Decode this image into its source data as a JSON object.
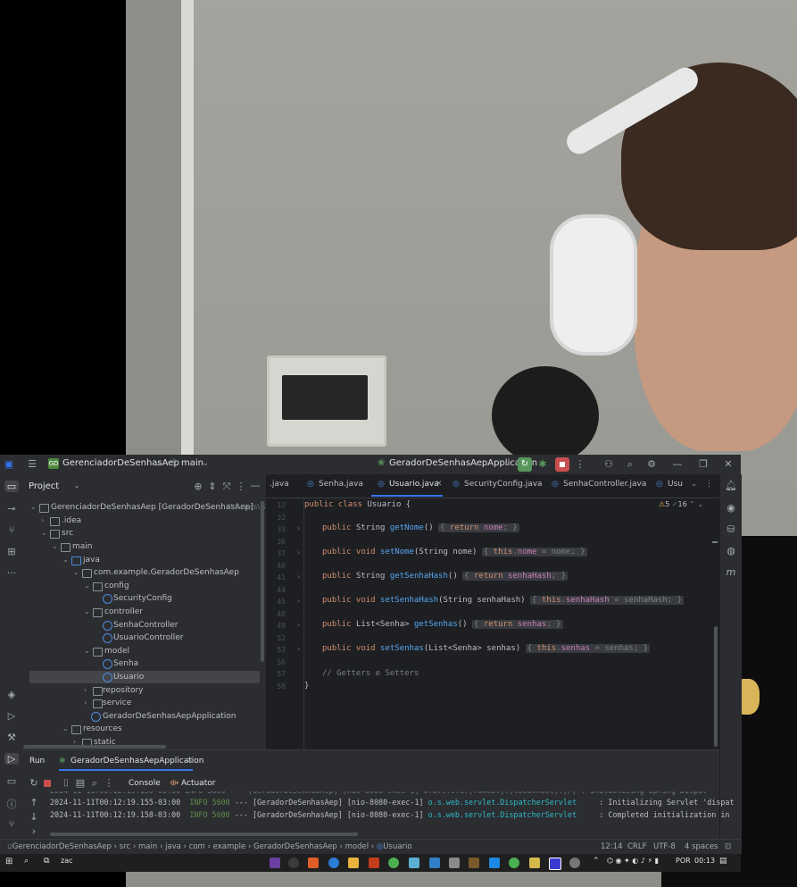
{
  "ide": {
    "project_name": "GerenciadorDeSenhasAep",
    "project_badge": "GD",
    "branch": "main",
    "run_config": "GeradorDeSenhasAepApplication",
    "window_controls": {
      "minimize": "—",
      "maximize": "❐",
      "close": "✕"
    }
  },
  "project_panel": {
    "title": "Project",
    "tree": [
      {
        "label": "GerenciadorDeSenhasAep [GeradorDeSenhasAep]",
        "hint": "C:\\Users\\G",
        "type": "folder"
      },
      {
        "label": ".idea",
        "type": "folder"
      },
      {
        "label": "src",
        "type": "folder"
      },
      {
        "label": "main",
        "type": "folder"
      },
      {
        "label": "java",
        "type": "folder"
      },
      {
        "label": "com.example.GeradorDeSenhasAep",
        "type": "package"
      },
      {
        "label": "config",
        "type": "package"
      },
      {
        "label": "SecurityConfig",
        "type": "class"
      },
      {
        "label": "controller",
        "type": "package"
      },
      {
        "label": "SenhaController",
        "type": "class"
      },
      {
        "label": "UsuarioController",
        "type": "class"
      },
      {
        "label": "model",
        "type": "package"
      },
      {
        "label": "Senha",
        "type": "class"
      },
      {
        "label": "Usuario",
        "type": "class"
      },
      {
        "label": "repository",
        "type": "package"
      },
      {
        "label": "service",
        "type": "package"
      },
      {
        "label": "GeradorDeSenhasAepApplication",
        "type": "class"
      },
      {
        "label": "resources",
        "type": "folder"
      },
      {
        "label": "static",
        "type": "folder"
      }
    ]
  },
  "editor": {
    "tabs": [
      {
        "label": ".java"
      },
      {
        "label": "Senha.java"
      },
      {
        "label": "Usuario.java"
      },
      {
        "label": "SecurityConfig.java"
      },
      {
        "label": "SenhaController.java"
      },
      {
        "label": "Usu"
      }
    ],
    "active_tab": "Usuario.java",
    "inspection": {
      "warnings": "5",
      "weak": "16"
    },
    "lines": [
      {
        "num": "12",
        "text": "public class Usuario {"
      },
      {
        "num": "32",
        "text": ""
      },
      {
        "num": "33",
        "text": "public String getNome() { return nome; }"
      },
      {
        "num": "36",
        "text": ""
      },
      {
        "num": "37",
        "text": "public void setNome(String nome) { this.nome = nome; }"
      },
      {
        "num": "40",
        "text": ""
      },
      {
        "num": "41",
        "text": "public String getSenhaHash() { return senhaHash; }"
      },
      {
        "num": "44",
        "text": ""
      },
      {
        "num": "45",
        "text": "public void setSenhaHash(String senhaHash) { this.senhaHash = senhaHash; }"
      },
      {
        "num": "48",
        "text": ""
      },
      {
        "num": "49",
        "text": "public List<Senha> getSenhas() { return senhas; }"
      },
      {
        "num": "52",
        "text": ""
      },
      {
        "num": "53",
        "text": "public void setSenhas(List<Senha> senhas) { this.senhas = senhas; }"
      },
      {
        "num": "56",
        "text": ""
      },
      {
        "num": "57",
        "text": "// Getters e Setters"
      },
      {
        "num": "58",
        "text": "}"
      }
    ]
  },
  "run_panel": {
    "run_label": "Run",
    "run_tab": "GeradorDeSenhasAepApplication",
    "console_label": "Console",
    "actuator_label": "Actuator",
    "logs": [
      {
        "time": "2024-11-11T00:12:19.155-03:00",
        "level": "INFO",
        "pid": "5600",
        "sep": "---",
        "app": "[GeradorDeSenhasAep]",
        "thread": "[nio-8080-exec-1]",
        "logger": "o.s.web.servlet.DispatcherServlet",
        "message": ": Initializing Servlet 'dispat"
      },
      {
        "time": "2024-11-11T00:12:19.158-03:00",
        "level": "INFO",
        "pid": "5600",
        "sep": "---",
        "app": "[GeradorDeSenhasAep]",
        "thread": "[nio-8080-exec-1]",
        "logger": "o.s.web.servlet.DispatcherServlet",
        "message": ": Completed initialization in"
      }
    ]
  },
  "status_bar": {
    "breadcrumb": [
      "GerenciadorDeSenhasAep",
      "src",
      "main",
      "java",
      "com",
      "example",
      "GeradorDeSenhasAep",
      "model",
      "Usuario"
    ],
    "position": "12:14",
    "line_sep": "CRLF",
    "encoding": "UTF-8",
    "indent": "4 spaces"
  },
  "taskbar": {
    "search_text": "zac",
    "language": "POR",
    "time": "00:13"
  },
  "colors": {
    "ide_bg": "#1e1f22",
    "panel_bg": "#2b2d30",
    "accent": "#3574f0",
    "keyword": "#cf8e6d",
    "method": "#56a8f5"
  }
}
